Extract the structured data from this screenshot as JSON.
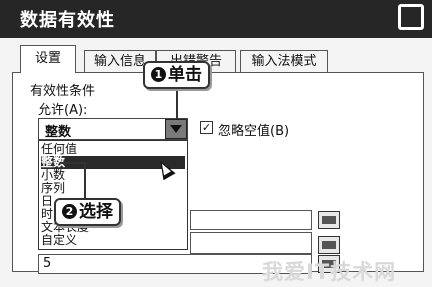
{
  "window": {
    "title": "数据有效性"
  },
  "tabs": [
    {
      "label": "设置"
    },
    {
      "label": "输入信息"
    },
    {
      "label": "出错警告"
    },
    {
      "label": "输入法模式"
    }
  ],
  "settings": {
    "group_label": "有效性条件",
    "allow_label": "允许(A):",
    "allow_value": "整数",
    "ignore_blank_label": "忽略空值(B)",
    "ignore_blank_checked": true,
    "dropdown_options": [
      "任何值",
      "整数",
      "小数",
      "序列",
      "日",
      "时",
      "文本长度",
      "自定义"
    ],
    "selected_option": "整数",
    "bottom_value": "5"
  },
  "annotations": [
    {
      "number": "1",
      "text": "单击"
    },
    {
      "number": "2",
      "text": "选择"
    }
  ],
  "watermark": "我爱IT技术网"
}
